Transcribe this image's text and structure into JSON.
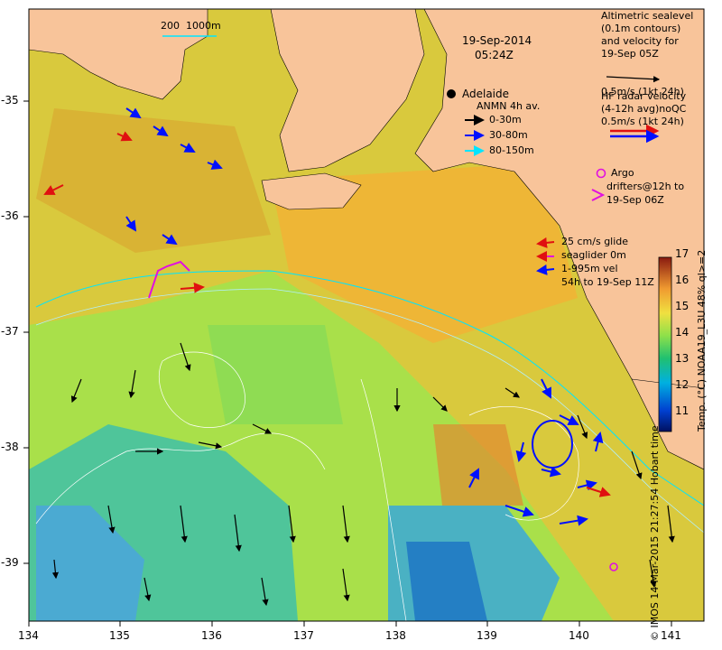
{
  "header": {
    "date": "19-Sep-2014",
    "time": "05:24Z",
    "scale_bar_label": "200  1000m"
  },
  "places": {
    "adelaide": "Adelaide"
  },
  "legend_anmn": {
    "title": "ANMN 4h av.",
    "items": [
      {
        "label": "0-30m",
        "color": "#000000"
      },
      {
        "label": "30-80m",
        "color": "#0000ff"
      },
      {
        "label": "80-150m",
        "color": "#00e5ff"
      }
    ]
  },
  "legend_altimetric": {
    "lines": [
      "Altimetric sealevel",
      "(0.1m contours)",
      "and velocity for",
      "19-Sep 05Z",
      "0.5m/s (1kt 24h)"
    ]
  },
  "legend_hf": {
    "lines": [
      "HF radar velocity",
      "(4-12h avg)noQC",
      "0.5m/s (1kt 24h)"
    ]
  },
  "legend_argo": {
    "lines": [
      "Argo",
      "drifters@12h to",
      "19-Sep 06Z"
    ]
  },
  "legend_glider": {
    "lines": [
      "25 cm/s glide",
      "seaglider 0m",
      "1-995m vel",
      "54h to 19-Sep 11Z"
    ]
  },
  "colorbar": {
    "title": "Temp. (°C) NOAA19_L3U 48% ql>=2",
    "ticks": [
      "17",
      "16",
      "15",
      "14",
      "13",
      "12",
      "11"
    ],
    "min": 10.3,
    "max": 17.0
  },
  "axes": {
    "x_ticks": [
      "134",
      "135",
      "136",
      "137",
      "138",
      "139",
      "140",
      "141"
    ],
    "y_ticks": [
      "-35",
      "-36",
      "-37",
      "-38",
      "-39"
    ],
    "x_range": [
      134,
      141.3
    ],
    "y_range": [
      -39.6,
      -34.2
    ]
  },
  "credit": "© IMOS 14-Mar-2015 21:27:54 Hobart time",
  "colors": {
    "land": "#f8c49a",
    "sst_warm": "#f2b134",
    "sst_mid": "#a9e04a",
    "sst_cool": "#3fb0c7",
    "ocean_deep": "#1a73c4"
  }
}
